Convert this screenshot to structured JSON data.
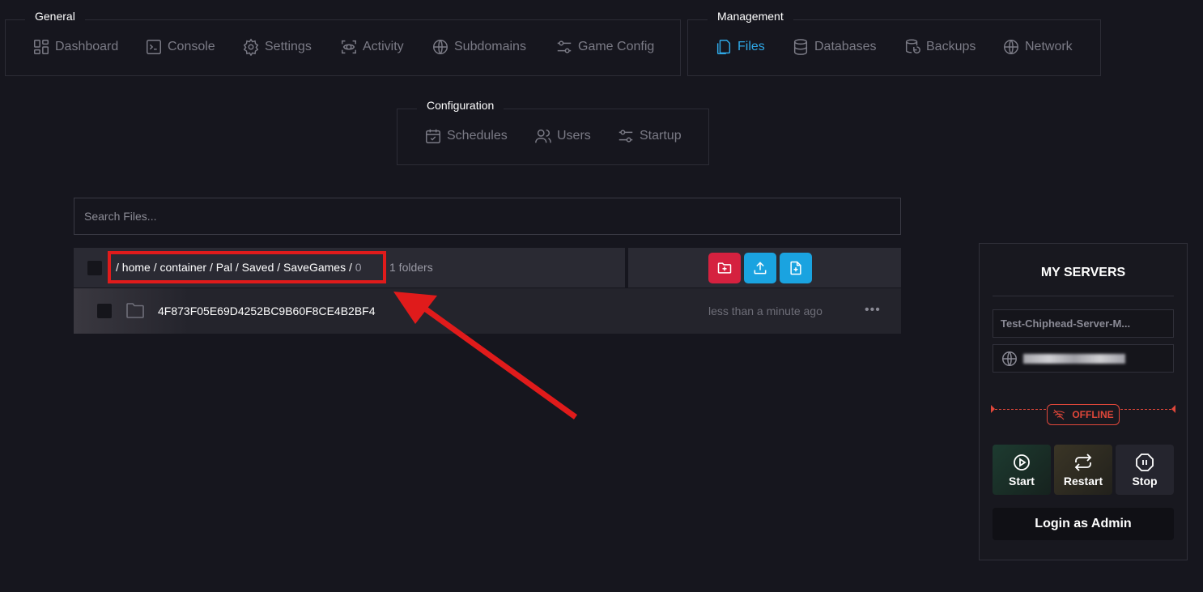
{
  "nav": {
    "general": {
      "title": "General",
      "items": [
        {
          "label": "Dashboard",
          "icon": "dashboard-icon"
        },
        {
          "label": "Console",
          "icon": "terminal-icon"
        },
        {
          "label": "Settings",
          "icon": "gear-icon"
        },
        {
          "label": "Activity",
          "icon": "activity-icon"
        },
        {
          "label": "Subdomains",
          "icon": "globe-icon"
        },
        {
          "label": "Game Config",
          "icon": "sliders-icon"
        }
      ]
    },
    "management": {
      "title": "Management",
      "items": [
        {
          "label": "Files",
          "icon": "files-icon",
          "active": true
        },
        {
          "label": "Databases",
          "icon": "database-icon"
        },
        {
          "label": "Backups",
          "icon": "backup-icon"
        },
        {
          "label": "Network",
          "icon": "globe-icon"
        }
      ]
    },
    "configuration": {
      "title": "Configuration",
      "items": [
        {
          "label": "Schedules",
          "icon": "calendar-icon"
        },
        {
          "label": "Users",
          "icon": "users-icon"
        },
        {
          "label": "Startup",
          "icon": "sliders-icon"
        }
      ]
    }
  },
  "files": {
    "search_placeholder": "Search Files...",
    "breadcrumb": {
      "sep": "/",
      "parts": [
        "home",
        "container",
        "Pal",
        "Saved",
        "SaveGames"
      ],
      "current": "0"
    },
    "folder_count": "1 folders",
    "rows": [
      {
        "name": "4F873F05E69D4252BC9B60F8CE4B2BF4",
        "modified": "less than a minute ago",
        "type": "folder"
      }
    ],
    "actions": [
      {
        "name": "new-folder",
        "color": "#d5213f"
      },
      {
        "name": "upload",
        "color": "#1aa3e0"
      },
      {
        "name": "new-file",
        "color": "#1aa3e0"
      }
    ]
  },
  "sidebar": {
    "title": "MY SERVERS",
    "server_name": "Test-Chiphead-Server-M...",
    "status": "OFFLINE",
    "buttons": {
      "start": "Start",
      "restart": "Restart",
      "stop": "Stop"
    },
    "login": "Login as Admin"
  },
  "colors": {
    "background": "#16161e",
    "accent": "#2fa8e6",
    "danger": "#e0473a",
    "annotation_red": "#e01b1b"
  }
}
